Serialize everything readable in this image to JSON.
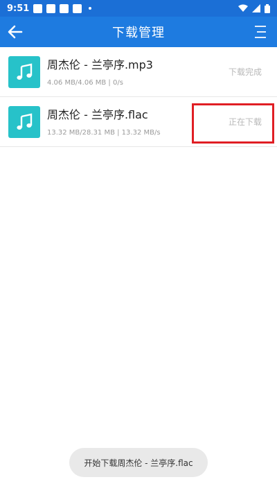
{
  "status_bar": {
    "time": "9:51"
  },
  "app_bar": {
    "title": "下载管理"
  },
  "downloads": [
    {
      "name": "周杰伦 - 兰亭序.mp3",
      "meta": "4.06 MB/4.06 MB | 0/s",
      "status": "下载完成"
    },
    {
      "name": "周杰伦 - 兰亭序.flac",
      "meta": "13.32 MB/28.31 MB | 13.32 MB/s",
      "status": "正在下载"
    }
  ],
  "toast": {
    "text": "开始下载周杰伦 - 兰亭序.flac"
  },
  "colors": {
    "status_bar": "#1b6fd6",
    "app_bar": "#1e7be0",
    "thumb": "#27c2c9",
    "highlight": "#e01e24"
  }
}
